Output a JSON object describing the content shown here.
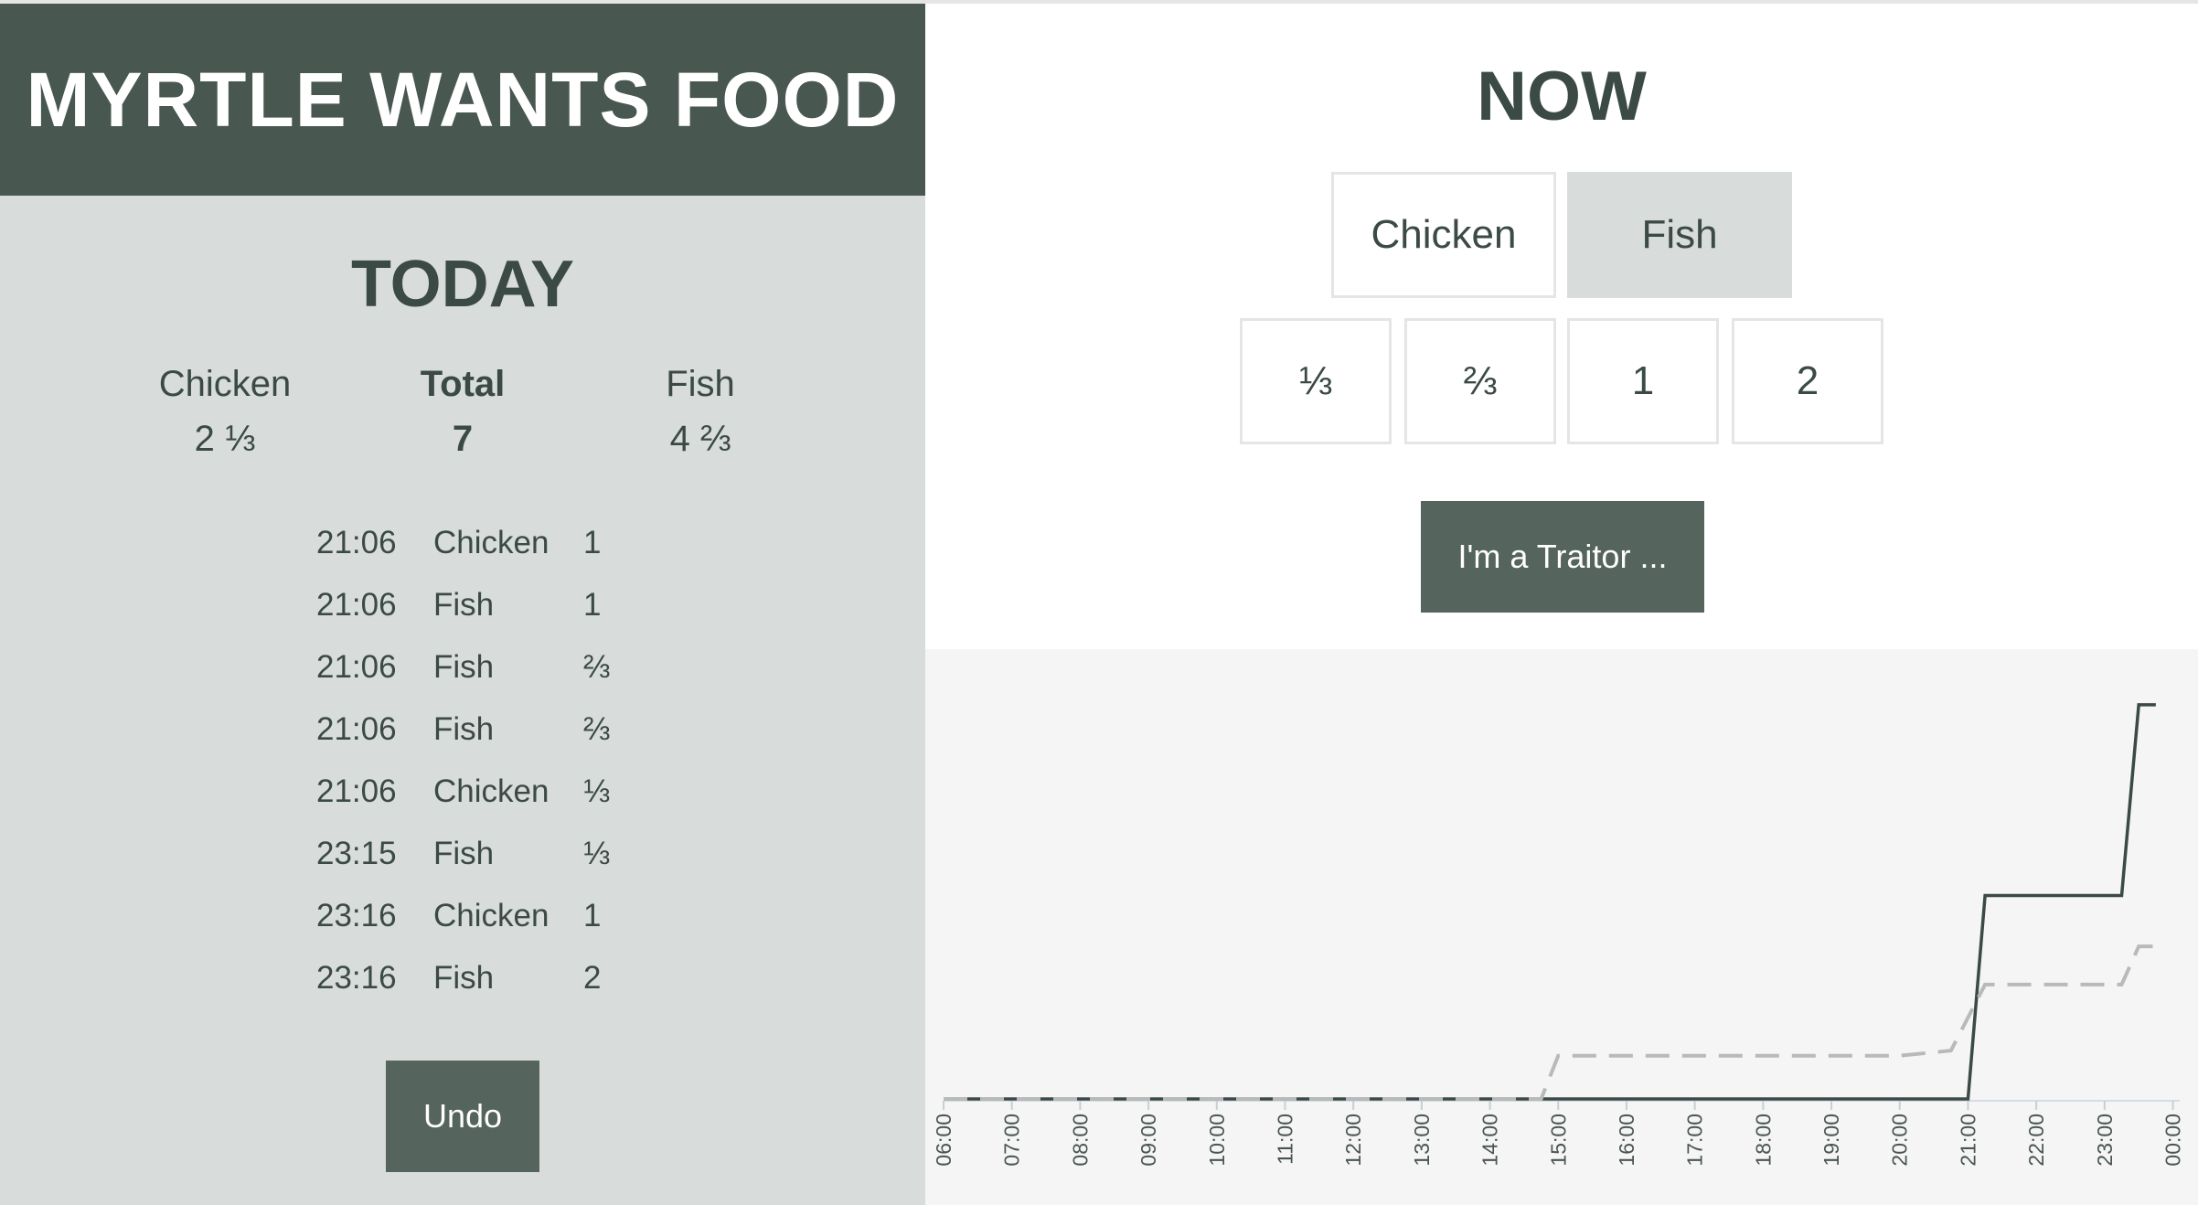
{
  "header": {
    "title": "MYRTLE WANTS FOOD"
  },
  "today": {
    "title": "TODAY",
    "chicken": {
      "label": "Chicken",
      "value": "2 ⅓"
    },
    "total": {
      "label": "Total",
      "value": "7"
    },
    "fish": {
      "label": "Fish",
      "value": "4 ⅔"
    },
    "log": [
      {
        "time": "21:06",
        "food": "Chicken",
        "amount": "1"
      },
      {
        "time": "21:06",
        "food": "Fish",
        "amount": "1"
      },
      {
        "time": "21:06",
        "food": "Fish",
        "amount": "⅔"
      },
      {
        "time": "21:06",
        "food": "Fish",
        "amount": "⅔"
      },
      {
        "time": "21:06",
        "food": "Chicken",
        "amount": "⅓"
      },
      {
        "time": "23:15",
        "food": "Fish",
        "amount": "⅓"
      },
      {
        "time": "23:16",
        "food": "Chicken",
        "amount": "1"
      },
      {
        "time": "23:16",
        "food": "Fish",
        "amount": "2"
      }
    ],
    "undo_label": "Undo"
  },
  "now": {
    "title": "NOW",
    "food_options": [
      "Chicken",
      "Fish"
    ],
    "selected_food": "Fish",
    "amounts": [
      "⅓",
      "⅔",
      "1",
      "2"
    ],
    "traitor_label": "I'm a Traitor ..."
  },
  "colors": {
    "dark": "#48574f",
    "button": "#55645d",
    "panel": "#d8dcdb",
    "chart_bg": "#f4f5f4",
    "solid_line": "#3b4a44",
    "dashed_line": "#b7bab8"
  },
  "chart_data": {
    "type": "line",
    "x_ticks": [
      "06:00",
      "07:00",
      "08:00",
      "09:00",
      "10:00",
      "11:00",
      "12:00",
      "13:00",
      "14:00",
      "15:00",
      "16:00",
      "17:00",
      "18:00",
      "19:00",
      "20:00",
      "21:00",
      "22:00",
      "23:00",
      "00:00"
    ],
    "xlim": [
      6,
      24.1
    ],
    "ylim": [
      0,
      6.5
    ],
    "grid": false,
    "legend": "none",
    "series": [
      {
        "style": "solid",
        "points": [
          [
            6,
            0
          ],
          [
            21.0,
            0
          ],
          [
            21.25,
            3.2
          ],
          [
            23.25,
            3.2
          ],
          [
            23.5,
            6.2
          ],
          [
            23.75,
            6.2
          ]
        ]
      },
      {
        "style": "dashed",
        "points": [
          [
            6,
            0
          ],
          [
            14.75,
            0
          ],
          [
            15.0,
            0.68
          ],
          [
            20.0,
            0.68
          ],
          [
            20.75,
            0.76
          ],
          [
            21.25,
            1.8
          ],
          [
            23.25,
            1.8
          ],
          [
            23.5,
            2.4
          ],
          [
            23.75,
            2.4
          ]
        ]
      }
    ]
  }
}
